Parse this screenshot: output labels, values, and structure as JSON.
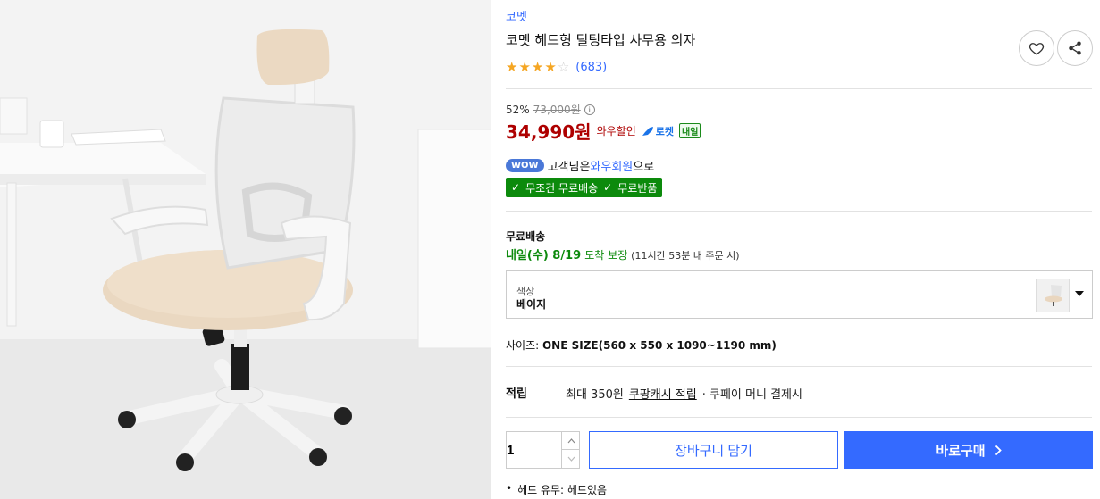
{
  "product": {
    "brand": "코멧",
    "title": "코멧 헤드형 틸팅타입 사무용 의자",
    "rating": {
      "stars": 4,
      "max": 5,
      "count_text": "(683)"
    },
    "image_alt_icon": "office-chair-photo"
  },
  "price": {
    "discount_rate": "52%",
    "original_price": "73,000원",
    "sale_price": "34,990원",
    "wow_sale_label": "와우할인",
    "rocket_label": "로켓",
    "tomorrow_label": "내일"
  },
  "wow": {
    "badge": "WOW",
    "text_prefix": "고객님은 ",
    "member_text": "와우회원",
    "text_suffix": "으로"
  },
  "benefits": [
    "무조건 무료배송",
    "무료반품"
  ],
  "shipping": {
    "title": "무료배송",
    "date": "내일(수) 8/19",
    "arrival_label": "도착 보장",
    "note": "(11시간 53분 내 주문 시)"
  },
  "option": {
    "label": "색상",
    "value": "베이지"
  },
  "size": {
    "label": "사이즈: ",
    "value": "ONE SIZE(560 x 550 x 1090~1190 mm)"
  },
  "reward": {
    "title": "적립",
    "max_text": "최대 350원",
    "link_text": "쿠팡캐시 적립",
    "suffix_text": "· 쿠페이 머니 결제시"
  },
  "purchase": {
    "quantity": "1",
    "cart_label": "장바구니 담기",
    "buy_label": "바로구매"
  },
  "spec_bullet": "헤드 유무: 헤드있음",
  "colors": {
    "accent": "#346aff",
    "price_red": "#ae0000",
    "green": "#0c8a0c",
    "star": "#f5a623"
  }
}
